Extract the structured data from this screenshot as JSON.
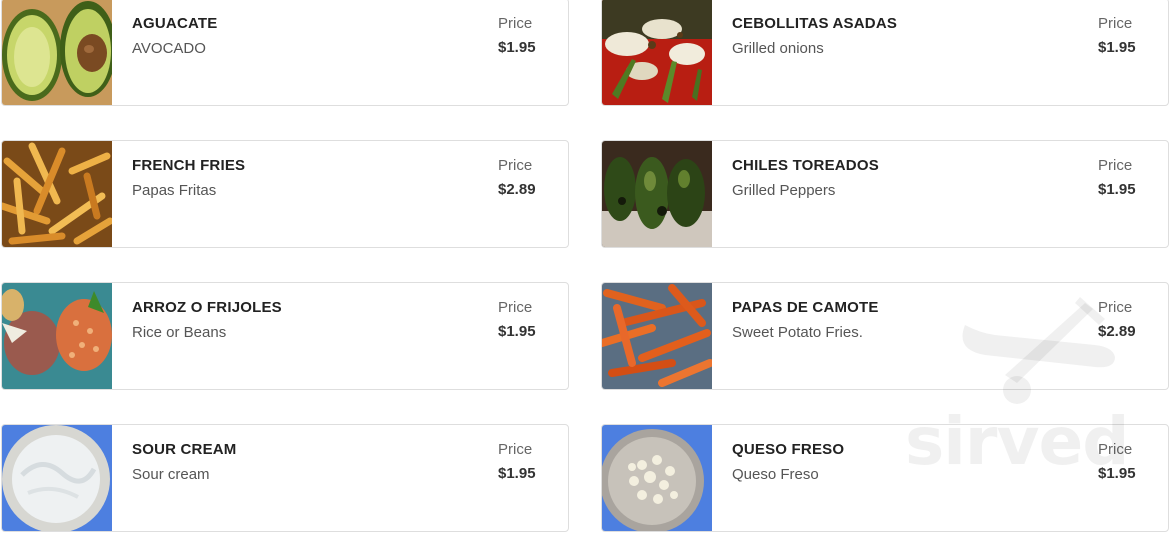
{
  "menu": {
    "items": [
      {
        "name": "AGUACATE",
        "description": "AVOCADO",
        "price_label": "Price",
        "price": "$1.95",
        "image_icon": "avocado-image"
      },
      {
        "name": "CEBOLLITAS ASADAS",
        "description": "Grilled onions",
        "price_label": "Price",
        "price": "$1.95",
        "image_icon": "grilled-onions-image"
      },
      {
        "name": "FRENCH FRIES",
        "description": "Papas Fritas",
        "price_label": "Price",
        "price": "$2.89",
        "image_icon": "french-fries-image"
      },
      {
        "name": "CHILES TOREADOS",
        "description": "Grilled Peppers",
        "price_label": "Price",
        "price": "$1.95",
        "image_icon": "grilled-peppers-image"
      },
      {
        "name": "ARROZ O FRIJOLES",
        "description": "Rice or Beans",
        "price_label": "Price",
        "price": "$1.95",
        "image_icon": "rice-beans-image"
      },
      {
        "name": "PAPAS DE CAMOTE",
        "description": "Sweet Potato Fries.",
        "price_label": "Price",
        "price": "$2.89",
        "image_icon": "sweet-potato-fries-image"
      },
      {
        "name": "SOUR CREAM",
        "description": "Sour cream",
        "price_label": "Price",
        "price": "$1.95",
        "image_icon": "sour-cream-image"
      },
      {
        "name": "QUESO FRESO",
        "description": "Queso Freso",
        "price_label": "Price",
        "price": "$1.95",
        "image_icon": "queso-fresco-image"
      }
    ]
  },
  "watermark": {
    "text": "sirved"
  }
}
